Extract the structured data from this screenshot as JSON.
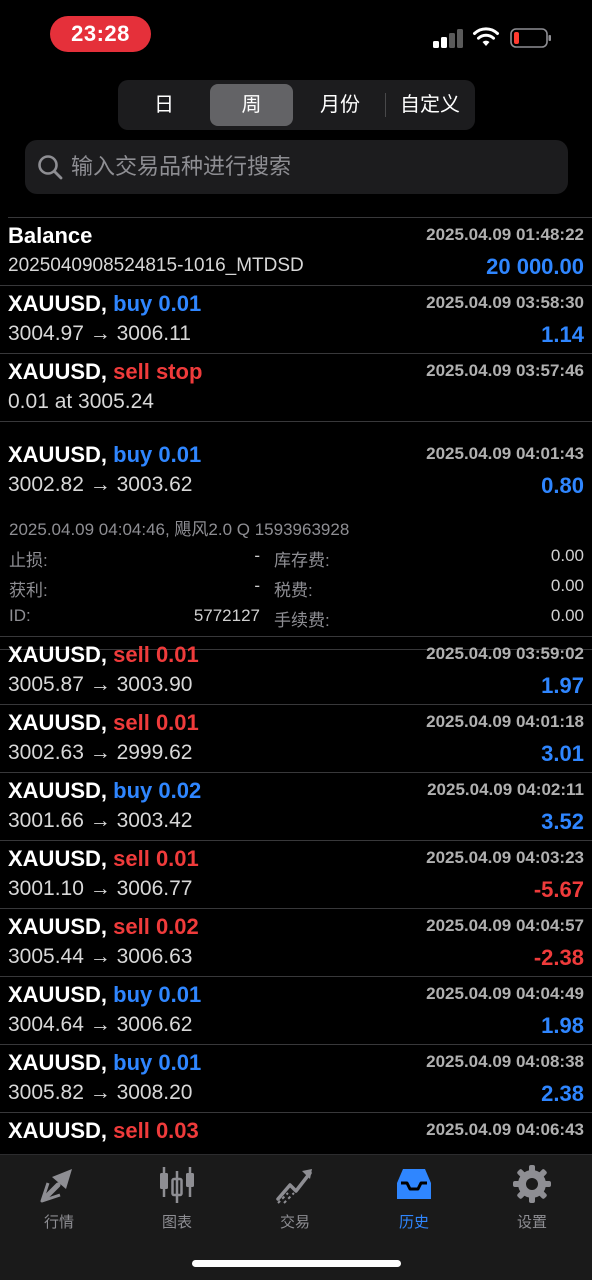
{
  "status_bar": {
    "time": "23:28",
    "accent_color": "#e5303a",
    "battery_color": "#ff3b30"
  },
  "period_tabs": [
    {
      "label": "日",
      "active": false
    },
    {
      "label": "周",
      "active": true
    },
    {
      "label": "月份",
      "active": false
    },
    {
      "label": "自定义",
      "active": false
    }
  ],
  "search": {
    "placeholder": "输入交易品种进行搜索",
    "value": "",
    "icon": "search-icon"
  },
  "balance_row": {
    "title": "Balance",
    "time": "2025.04.09 01:48:22",
    "comment": "2025040908524815-1016_MTDSD",
    "amount": "20 000.00"
  },
  "rows_before": [
    {
      "symbol": "XAUUSD,",
      "action": "buy 0.01",
      "side": "buy",
      "time": "2025.04.09 03:58:30",
      "prices": "3004.97 → 3006.11",
      "profit": "1.14",
      "profit_sign": "pos"
    },
    {
      "symbol": "XAUUSD,",
      "action": "sell stop",
      "side": "sell",
      "time": "2025.04.09 03:57:46",
      "prices": "0.01 at 3005.24",
      "profit": "",
      "profit_sign": "pos"
    }
  ],
  "expanded_row": {
    "symbol": "XAUUSD,",
    "action": "buy 0.01",
    "side": "buy",
    "time": "2025.04.09 04:01:43",
    "prices": "3002.82 → 3003.62",
    "profit": "0.80",
    "comment": "2025.04.09 04:04:46, 飓风2.0 Q 1593963928",
    "fields": {
      "sl_label": "止损:",
      "sl_value": "-",
      "swap_label": "库存费:",
      "swap_value": "0.00",
      "tp_label": "获利:",
      "tp_value": "-",
      "tax_label": "税费:",
      "tax_value": "0.00",
      "id_label": "ID:",
      "id_value": "5772127",
      "fee_label": "手续费:",
      "fee_value": "0.00"
    }
  },
  "rows_after": [
    {
      "symbol": "XAUUSD,",
      "action": "sell 0.01",
      "side": "sell",
      "time": "2025.04.09 03:59:02",
      "prices": "3005.87 → 3003.90",
      "profit": "1.97",
      "profit_sign": "pos"
    },
    {
      "symbol": "XAUUSD,",
      "action": "sell 0.01",
      "side": "sell",
      "time": "2025.04.09 04:01:18",
      "prices": "3002.63 → 2999.62",
      "profit": "3.01",
      "profit_sign": "pos"
    },
    {
      "symbol": "XAUUSD,",
      "action": "buy 0.02",
      "side": "buy",
      "time": "2025.04.09 04:02:11",
      "prices": "3001.66 → 3003.42",
      "profit": "3.52",
      "profit_sign": "pos"
    },
    {
      "symbol": "XAUUSD,",
      "action": "sell 0.01",
      "side": "sell",
      "time": "2025.04.09 04:03:23",
      "prices": "3001.10 → 3006.77",
      "profit": "-5.67",
      "profit_sign": "neg"
    },
    {
      "symbol": "XAUUSD,",
      "action": "sell 0.02",
      "side": "sell",
      "time": "2025.04.09 04:04:57",
      "prices": "3005.44 → 3006.63",
      "profit": "-2.38",
      "profit_sign": "neg"
    },
    {
      "symbol": "XAUUSD,",
      "action": "buy 0.01",
      "side": "buy",
      "time": "2025.04.09 04:04:49",
      "prices": "3004.64 → 3006.62",
      "profit": "1.98",
      "profit_sign": "pos"
    },
    {
      "symbol": "XAUUSD,",
      "action": "buy 0.01",
      "side": "buy",
      "time": "2025.04.09 04:08:38",
      "prices": "3005.82 → 3008.20",
      "profit": "2.38",
      "profit_sign": "pos"
    },
    {
      "symbol": "XAUUSD,",
      "action": "sell 0.03",
      "side": "sell",
      "time": "2025.04.09 04:06:43",
      "prices": "",
      "profit": "",
      "profit_sign": "pos"
    }
  ],
  "tab_bar": [
    {
      "label": "行情",
      "icon": "quotes-arrows-icon",
      "active": false
    },
    {
      "label": "图表",
      "icon": "candlestick-chart-icon",
      "active": false
    },
    {
      "label": "交易",
      "icon": "trade-trend-icon",
      "active": false
    },
    {
      "label": "历史",
      "icon": "history-inbox-icon",
      "active": true
    },
    {
      "label": "设置",
      "icon": "gear-icon",
      "active": false
    }
  ],
  "colors": {
    "buy": "#2f86ff",
    "sell": "#ef3b3b",
    "active_tab": "#2f86ff",
    "background": "#000000"
  }
}
